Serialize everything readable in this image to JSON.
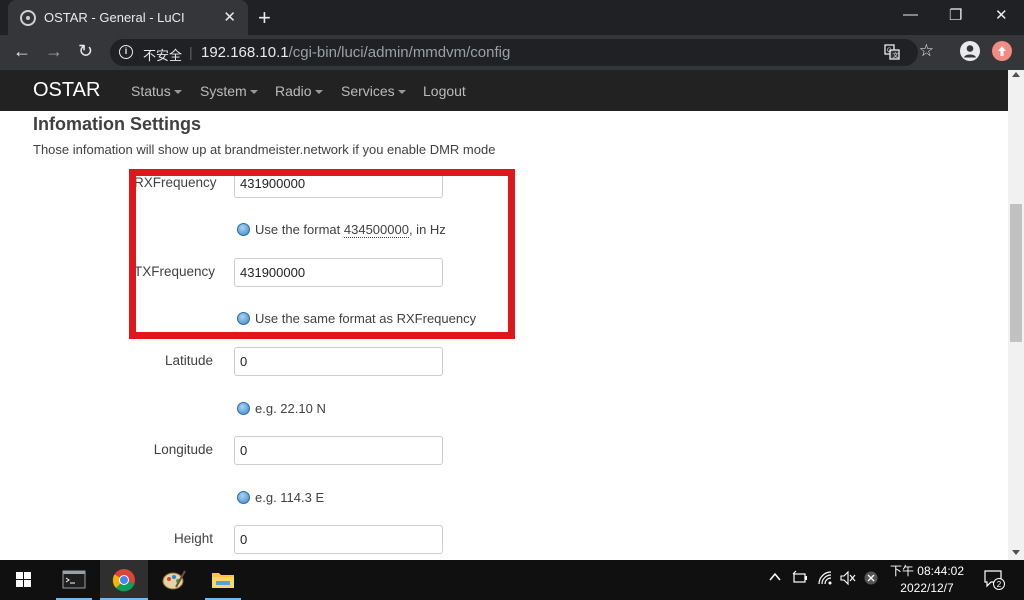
{
  "browser": {
    "tab_title": "OSTAR - General - LuCI",
    "tab_close": "✕",
    "new_tab": "+",
    "window_controls": {
      "minimize": "—",
      "restore": "❐",
      "close": "✕"
    },
    "nav": {
      "back": "←",
      "forward": "→",
      "reload": "↻"
    },
    "omnibox": {
      "security_text": "不安全",
      "separator": "|",
      "host": "192.168.10.1",
      "path": "/cgi-bin/luci/admin/mmdvm/config"
    }
  },
  "page": {
    "brand": "OSTAR",
    "menu": [
      "Status",
      "System",
      "Radio",
      "Services",
      "Logout"
    ],
    "section_title": "Infomation Settings",
    "section_desc": "Those infomation will show up at brandmeister.network if you enable DMR mode",
    "fields": [
      {
        "label": "RXFrequency",
        "value": "431900000",
        "hint_prefix": "Use the format ",
        "hint_emph": "434500000",
        "hint_suffix": ", in Hz"
      },
      {
        "label": "TXFrequency",
        "value": "431900000",
        "hint": "Use the same format as RXFrequency"
      },
      {
        "label": "Latitude",
        "value": "0",
        "hint": "e.g. 22.10 N"
      },
      {
        "label": "Longitude",
        "value": "0",
        "hint": "e.g. 114.3 E"
      },
      {
        "label": "Height",
        "value": "0"
      }
    ],
    "highlight_color": "#e0161b"
  },
  "taskbar": {
    "clock_time": "下午 08:44:02",
    "clock_date": "2022/12/7",
    "notification_count": "2"
  }
}
